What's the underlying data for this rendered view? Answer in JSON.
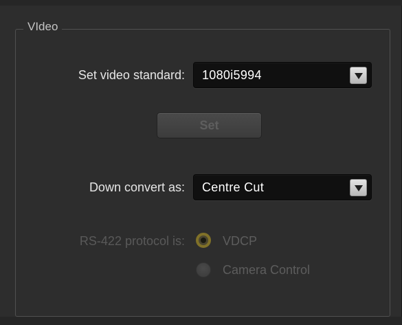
{
  "group": {
    "title": "VIdeo"
  },
  "video_standard": {
    "label": "Set video standard:",
    "value": "1080i5994"
  },
  "set_button": {
    "label": "Set"
  },
  "down_convert": {
    "label": "Down convert as:",
    "value": "Centre Cut"
  },
  "rs422": {
    "label": "RS-422 protocol is:",
    "options": [
      {
        "label": "VDCP",
        "selected": true
      },
      {
        "label": "Camera Control",
        "selected": false
      }
    ]
  }
}
